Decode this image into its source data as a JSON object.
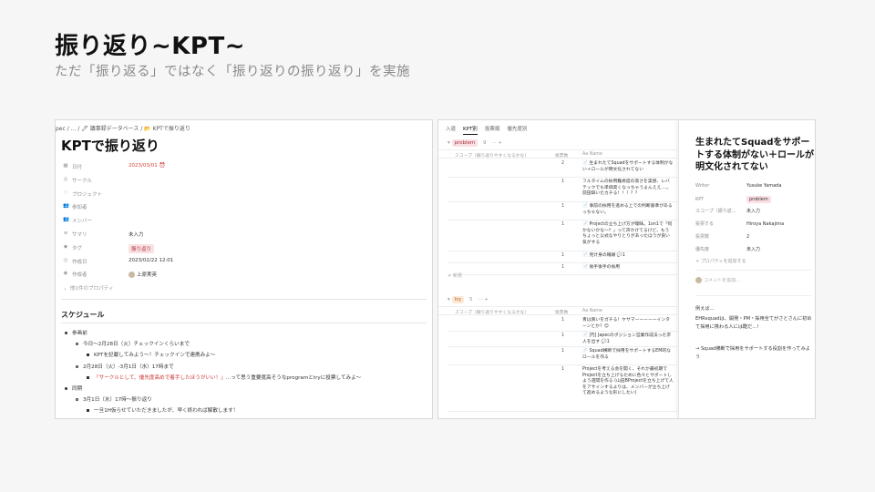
{
  "slide": {
    "title": "振り返り~KPT~",
    "subtitle": "ただ「振り返る」ではなく「振り返りの振り返り」を実施"
  },
  "left": {
    "breadcrumb": "pec / ... / 🖋 議事録データベース / 📂 KPTで振り返り",
    "page_title": "KPTで振り返り",
    "properties": [
      {
        "icon": "calendar-icon",
        "glyph": "▦",
        "key": "日付",
        "value": "2023/03/01 ⏰",
        "style": "red"
      },
      {
        "icon": "circle-icon",
        "glyph": "◎",
        "key": "サークル",
        "value": ""
      },
      {
        "icon": "heart-icon",
        "glyph": "♡",
        "key": "プロジェクト",
        "value": ""
      },
      {
        "icon": "people-icon",
        "glyph": "👥",
        "key": "参加者",
        "value": ""
      },
      {
        "icon": "people-icon",
        "glyph": "👥",
        "key": "メンバー",
        "value": ""
      },
      {
        "icon": "lines-icon",
        "glyph": "≡",
        "key": "サマリ",
        "value": "未入力"
      },
      {
        "icon": "tag-icon",
        "glyph": "◆",
        "key": "タグ",
        "value": "振り返り",
        "style": "tag"
      },
      {
        "icon": "clock-icon",
        "glyph": "◷",
        "key": "作成日",
        "value": "2023/02/22 12:01"
      },
      {
        "icon": "user-icon",
        "glyph": "◉",
        "key": "作成者",
        "value": "上原実英",
        "style": "avatar"
      }
    ],
    "hidden_props": "他1件のプロパティ",
    "schedule_heading": "スケジュール",
    "schedule": [
      {
        "level": 1,
        "text": "参画前"
      },
      {
        "level": 2,
        "text": "今日〜2月28日（火）チェックインくらいまで"
      },
      {
        "level": 3,
        "text": "KPTを記載してみよう〜！チェックインで連携みよ〜"
      },
      {
        "level": 2,
        "text": "2月28日（火）-3月1日（水）17時まで"
      },
      {
        "level": 3,
        "text_red": "「サークルとして、優先度高めで着手したほうがいい！」",
        "text": "...って思う重要度高そうなprogramとtryに投票してみよ〜"
      },
      {
        "level": 1,
        "text": "同期"
      },
      {
        "level": 2,
        "text": "3月1日（水）17時〜振り返り"
      },
      {
        "level": 3,
        "text": "一旦1H仮らせていただきましたが、早く終われば解散します！"
      }
    ]
  },
  "right": {
    "tabs": [
      "入退",
      "KPT別",
      "投票順",
      "優先度別"
    ],
    "group1": {
      "tag": "problem",
      "count": "9",
      "controls": "⋯ +"
    },
    "group2": {
      "tag": "try",
      "count": "5",
      "controls": "⋯ +"
    },
    "columns": {
      "scope": "スコープ（振り返りやすくなるかな）",
      "votes": "投票数",
      "name": "Aa Name"
    },
    "problem_rows": [
      {
        "votes": "2",
        "text": "📄 生まれたてSquadをサポートする体制がない＋ロールが明文化されてない"
      },
      {
        "votes": "1",
        "text": "フルタイムの採用難易度の高さを実感、レバテックでも単価高くなっちゃうよんええ....。前田辞いたカチる！！！？？"
      },
      {
        "votes": "1",
        "text": "📄 事前の採用を進める上での判断基準があるっちゃない。"
      },
      {
        "votes": "1",
        "text": "📄 Projectの立ち上げ方が曖昧。1on1で「何かないかな〜？」って声かけてるけど、もうちょっと公式なやりとりがあったほうが良い気がする"
      },
      {
        "votes": "1",
        "text": "📄 見计身の報酬 💬1"
      },
      {
        "votes": "1",
        "text": "📄 後手後手の採用"
      }
    ],
    "add_label": "+ 新規",
    "try_rows": [
      {
        "votes": "1",
        "text": "青は買いをガチる！ヤサマーーーーーインターンとか？😊"
      },
      {
        "votes": "1",
        "text": "📄 [FJ] Japecのポジション営業作成法った求人を出す 💬1"
      },
      {
        "votes": "1",
        "text": "📄 Squad横断で採用をサポートするEM的なロールを作る"
      },
      {
        "votes": "1",
        "text": "Projectを考える会を開く、それか最初期でProjectを立ち上げるために色々とサポートしよう週間を作る (山田BProjectを立ち上げて人をアサインするよりは、メンバーが立ち上げて進めるような形にしたい)"
      }
    ],
    "panel": {
      "title": "生まれたてSquadをサポートする体制がない＋ロールが明文化されてない",
      "props": [
        {
          "key": "Writer",
          "value": "Yusuke Yamada"
        },
        {
          "key": "KPT",
          "value": "problem",
          "style": "tag"
        },
        {
          "key": "スコープ（振り返...",
          "value": "未入力"
        },
        {
          "key": "投票する",
          "value": "Hiroya Nakajima"
        },
        {
          "key": "投票数",
          "value": "2"
        },
        {
          "key": "優先度",
          "value": "未入力"
        }
      ],
      "add_prop": "+ プロパティを追加する",
      "comment_placeholder": "コメントを追加...",
      "body1": "例えば...",
      "body2": "EHRsquadは、開発・PM・採用全てがさとさんに初めて採用に携わる人には酷だ...！",
      "body3": "→ Squad横断で採用をサポートする役割を作ってみよう"
    }
  }
}
